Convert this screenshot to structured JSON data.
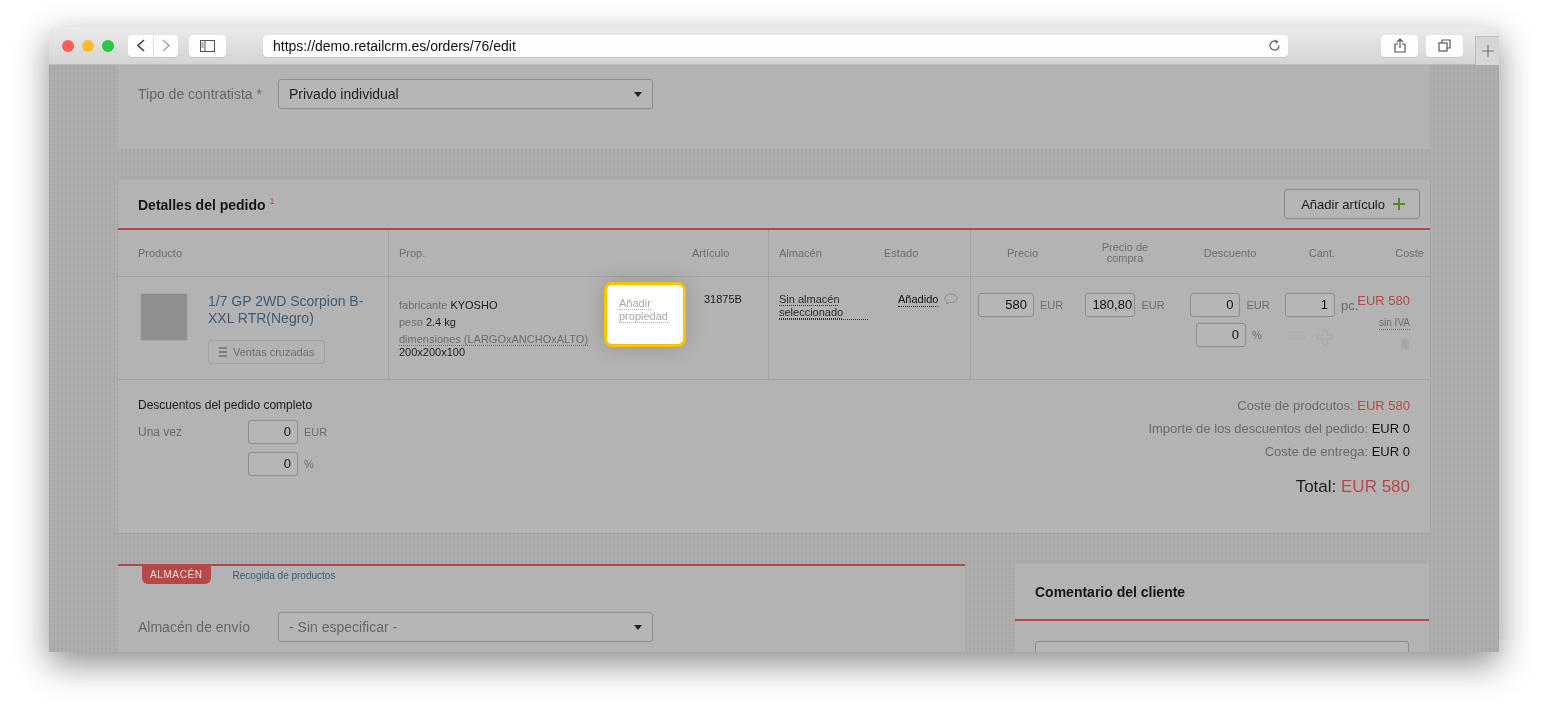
{
  "browser": {
    "url": "https://demo.retailcrm.es/orders/76/edit"
  },
  "contractor": {
    "label": "Tipo de contratista",
    "required_mark": "*",
    "value": "Privado individual"
  },
  "order_details": {
    "title": "Detalles del pedido",
    "title_mark": "1",
    "add_button": "Añadir artículo",
    "columns": [
      "Producto",
      "Prop.",
      "Artículo",
      "Almacén",
      "Estado",
      "Precio",
      "Precio de compra",
      "Descuento",
      "Cant.",
      "Coste"
    ],
    "item": {
      "name": "1/7 GP 2WD Scorpion B-XXL RTR(Negro)",
      "cross_sell": "Ventas cruzadas",
      "properties": [
        {
          "name": "fabricante",
          "value": "KYOSHO"
        },
        {
          "name": "peso",
          "value": "2.4 kg"
        },
        {
          "name": "dimensiones (LARGOxANCHOxALTO)",
          "value": "200x200x100"
        }
      ],
      "add_property": "Añadir propiedad",
      "article": "31875B",
      "warehouse": "Sin almacén seleccionado",
      "status": "Añadido",
      "price": "580",
      "price_currency": "EUR",
      "purchase_price": "180,80",
      "purchase_currency": "EUR",
      "discount": "0",
      "discount_currency": "EUR",
      "discount_percent": "0",
      "percent_sign": "%",
      "quantity": "1",
      "unit": "pc.",
      "cost": "EUR 580",
      "vat_note": "sin IVA"
    }
  },
  "order_discounts": {
    "title": "Descuentos del pedido completo",
    "label": "Una vez",
    "amount": "0",
    "currency": "EUR",
    "percent": "0",
    "percent_sign": "%"
  },
  "totals": [
    {
      "label": "Coste de prodcutos:",
      "value": "EUR 580",
      "kind": "accent"
    },
    {
      "label": "Importe de los descuentos del pedido:",
      "value": "EUR 0",
      "kind": "plain"
    },
    {
      "label": "Coste de entrega:",
      "value": "EUR 0",
      "kind": "plain"
    }
  ],
  "total": {
    "label": "Total:",
    "value": "EUR 580"
  },
  "shipping": {
    "tabs": [
      {
        "label": "ALMACÉN",
        "selected": true
      },
      {
        "label": "Recogida de productos",
        "selected": false
      }
    ],
    "label": "Almacén de envío",
    "value": "- Sin especificar -"
  },
  "customer_comment": {
    "title": "Comentario del cliente"
  }
}
